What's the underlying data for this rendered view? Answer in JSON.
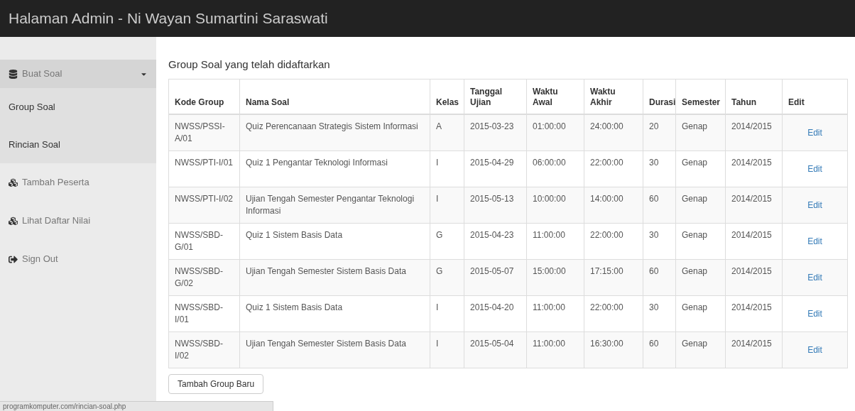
{
  "header": {
    "title": "Halaman Admin - Ni Wayan Sumartini Saraswati"
  },
  "sidebar": {
    "items": [
      {
        "label": "Buat Soal",
        "kind": "dropdown",
        "expanded": true,
        "children": [
          {
            "label": "Group Soal"
          },
          {
            "label": "Rincian Soal"
          }
        ]
      },
      {
        "label": "Tambah Peserta",
        "kind": "group"
      },
      {
        "label": "Lihat Daftar Nilai",
        "kind": "group"
      },
      {
        "label": "Sign Out",
        "kind": "logout"
      }
    ]
  },
  "main": {
    "heading": "Group Soal yang telah didaftarkan",
    "table": {
      "columns": [
        "Kode Group",
        "Nama Soal",
        "Kelas",
        "Tanggal Ujian",
        "Waktu Awal",
        "Waktu Akhir",
        "Durasi",
        "Semester",
        "Tahun",
        "Edit"
      ],
      "rows": [
        {
          "cells": [
            "NWSS/PSSI-A/01",
            "Quiz Perencanaan Strategis Sistem Informasi",
            "A",
            "2015-03-23",
            "01:00:00",
            "24:00:00",
            "20",
            "Genap",
            "2014/2015"
          ],
          "action": "Edit"
        },
        {
          "cells": [
            "NWSS/PTI-I/01",
            "Quiz 1 Pengantar Teknologi Informasi",
            "I",
            "2015-04-29",
            "06:00:00",
            "22:00:00",
            "30",
            "Genap",
            "2014/2015"
          ],
          "action": "Edit"
        },
        {
          "cells": [
            "NWSS/PTI-I/02",
            "Ujian Tengah Semester Pengantar Teknologi Informasi",
            "I",
            "2015-05-13",
            "10:00:00",
            "14:00:00",
            "60",
            "Genap",
            "2014/2015"
          ],
          "action": "Edit"
        },
        {
          "cells": [
            "NWSS/SBD-G/01",
            "Quiz 1 Sistem Basis Data",
            "G",
            "2015-04-23",
            "11:00:00",
            "22:00:00",
            "30",
            "Genap",
            "2014/2015"
          ],
          "action": "Edit"
        },
        {
          "cells": [
            "NWSS/SBD-G/02",
            "Ujian Tengah Semester Sistem Basis Data",
            "G",
            "2015-05-07",
            "15:00:00",
            "17:15:00",
            "60",
            "Genap",
            "2014/2015"
          ],
          "action": "Edit"
        },
        {
          "cells": [
            "NWSS/SBD-I/01",
            "Quiz 1 Sistem Basis Data",
            "I",
            "2015-04-20",
            "11:00:00",
            "22:00:00",
            "30",
            "Genap",
            "2014/2015"
          ],
          "action": "Edit"
        },
        {
          "cells": [
            "NWSS/SBD-I/02",
            "Ujian Tengah Semester Sistem Basis Data",
            "I",
            "2015-05-04",
            "11:00:00",
            "16:30:00",
            "60",
            "Genap",
            "2014/2015"
          ],
          "action": "Edit"
        }
      ]
    },
    "button": "Tambah Group Baru"
  },
  "status_bar": {
    "url": "programkomputer.com/rincian-soal.php"
  }
}
